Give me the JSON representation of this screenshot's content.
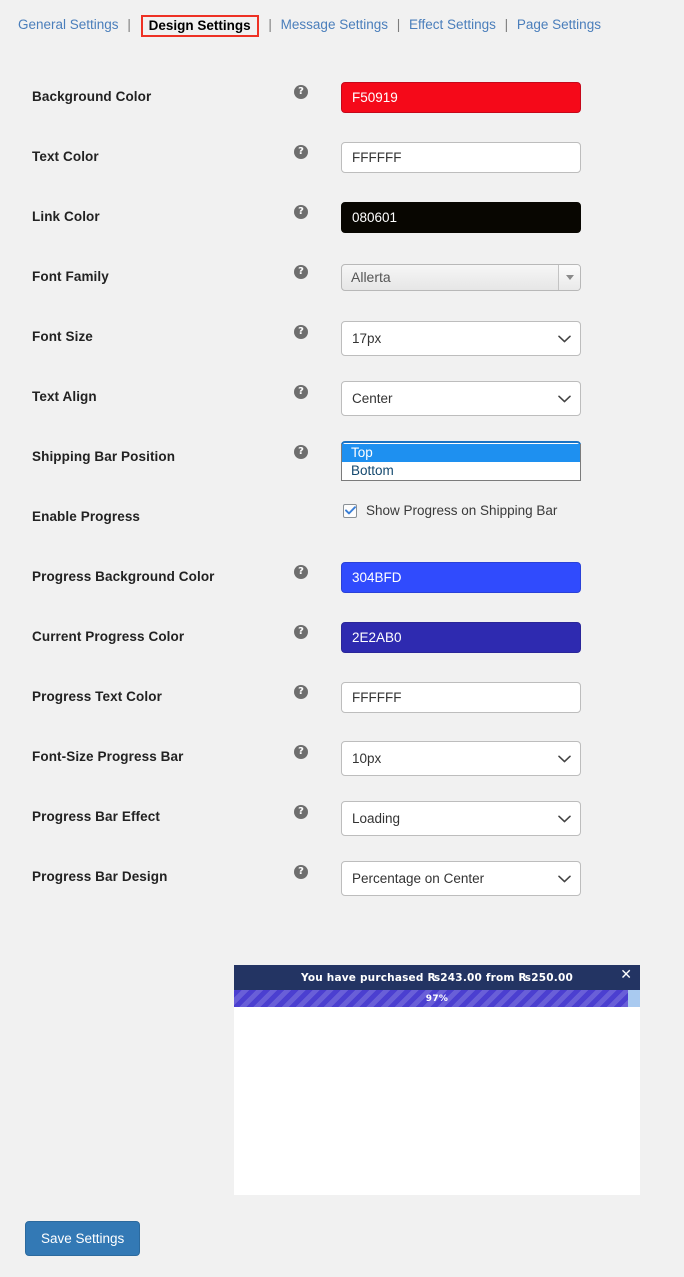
{
  "tabs": [
    {
      "label": "General Settings",
      "active": false
    },
    {
      "label": "Design Settings",
      "active": true
    },
    {
      "label": "Message Settings",
      "active": false
    },
    {
      "label": "Effect Settings",
      "active": false
    },
    {
      "label": "Page Settings",
      "active": false
    }
  ],
  "tab_separator": "|",
  "help_glyph": "?",
  "fields": {
    "background_color": {
      "label": "Background Color",
      "value": "F50919"
    },
    "text_color": {
      "label": "Text Color",
      "value": "FFFFFF"
    },
    "link_color": {
      "label": "Link Color",
      "value": "080601"
    },
    "font_family": {
      "label": "Font Family",
      "value": "Allerta"
    },
    "font_size": {
      "label": "Font Size",
      "value": "17px"
    },
    "text_align": {
      "label": "Text Align",
      "value": "Center"
    },
    "shipping_bar_position": {
      "label": "Shipping Bar Position",
      "value": "Top",
      "options": [
        "Top",
        "Bottom"
      ],
      "highlighted": "Top"
    },
    "enable_progress": {
      "label": "Enable Progress",
      "checkbox_label": "Show Progress on Shipping Bar",
      "checked": true
    },
    "progress_background_color": {
      "label": "Progress Background Color",
      "value": "304BFD"
    },
    "current_progress_color": {
      "label": "Current Progress Color",
      "value": "2E2AB0"
    },
    "progress_text_color": {
      "label": "Progress Text Color",
      "value": "FFFFFF"
    },
    "font_size_progress_bar": {
      "label": "Font-Size Progress Bar",
      "value": "10px"
    },
    "progress_bar_effect": {
      "label": "Progress Bar Effect",
      "value": "Loading"
    },
    "progress_bar_design": {
      "label": "Progress Bar Design",
      "value": "Percentage on Center"
    }
  },
  "preview": {
    "message": "You have purchased ₨243.00 from ₨250.00",
    "percent_label": "97%",
    "percent_value": 97,
    "close_glyph": "✕"
  },
  "actions": {
    "save_label": "Save Settings"
  },
  "colors": {
    "background_color": "#F50919",
    "link_color": "#080601",
    "progress_background_color": "#304BFD",
    "current_progress_color": "#2E2AB0",
    "accent_link": "#4a7ebb",
    "annotation_red": "#ee3124",
    "save_button": "#3379b5",
    "preview_header": "#233463"
  }
}
